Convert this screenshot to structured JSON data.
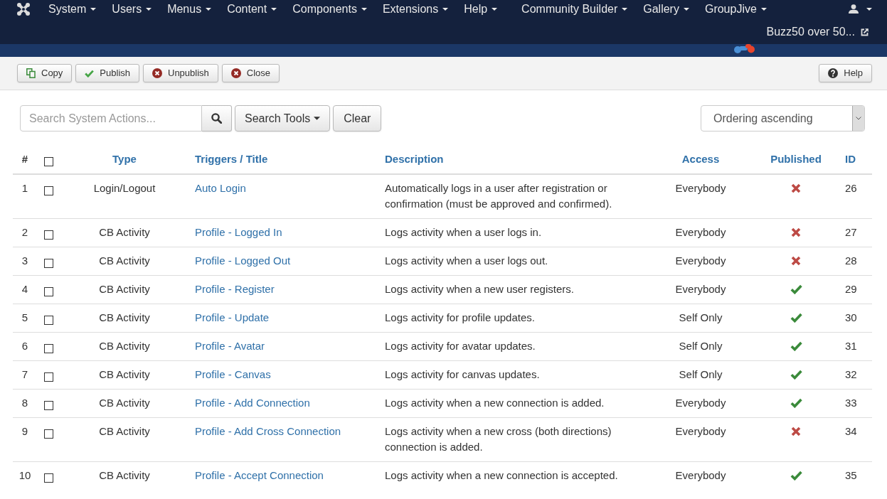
{
  "navbar": {
    "menus": [
      {
        "label": "System"
      },
      {
        "label": "Users"
      },
      {
        "label": "Menus"
      },
      {
        "label": "Content"
      },
      {
        "label": "Components"
      },
      {
        "label": "Extensions"
      },
      {
        "label": "Help"
      }
    ],
    "extension_menus": [
      {
        "label": "Community Builder"
      },
      {
        "label": "Gallery"
      },
      {
        "label": "GroupJive"
      }
    ],
    "site_link": {
      "label": "Buzz50 over 50..."
    }
  },
  "toolbar": {
    "buttons": [
      {
        "kind": "copy",
        "label": "Copy"
      },
      {
        "kind": "publish",
        "label": "Publish"
      },
      {
        "kind": "unpublish",
        "label": "Unpublish"
      },
      {
        "kind": "close",
        "label": "Close"
      }
    ],
    "help_button": {
      "label": "Help"
    }
  },
  "filters": {
    "search": {
      "placeholder": "Search System Actions..."
    },
    "search_tools": {
      "label": "Search Tools"
    },
    "clear": {
      "label": "Clear"
    },
    "ordering": {
      "value": "Ordering ascending"
    }
  },
  "table": {
    "columns": [
      {
        "kind": "plain",
        "label": "#"
      },
      {
        "kind": "checkbox",
        "checked": false
      },
      {
        "kind": "sortable",
        "label": "Type"
      },
      {
        "kind": "sortable",
        "label": "Triggers / Title"
      },
      {
        "kind": "sortable",
        "label": "Description"
      },
      {
        "kind": "sortable",
        "label": "Access"
      },
      {
        "kind": "sortable",
        "label": "Published"
      },
      {
        "kind": "sortable",
        "label": "ID"
      }
    ],
    "rows": [
      {
        "number": "1",
        "checked": false,
        "type": "Login/Logout",
        "title": "Auto Login",
        "description": "Automatically logs in a user after registration or confirmation (must be approved and confirmed).",
        "access": "Everybody",
        "published": false,
        "id": "26"
      },
      {
        "number": "2",
        "checked": false,
        "type": "CB Activity",
        "title": "Profile - Logged In",
        "description": "Logs activity when a user logs in.",
        "access": "Everybody",
        "published": false,
        "id": "27"
      },
      {
        "number": "3",
        "checked": false,
        "type": "CB Activity",
        "title": "Profile - Logged Out",
        "description": "Logs activity when a user logs out.",
        "access": "Everybody",
        "published": false,
        "id": "28"
      },
      {
        "number": "4",
        "checked": false,
        "type": "CB Activity",
        "title": "Profile - Register",
        "description": "Logs activity when a new user registers.",
        "access": "Everybody",
        "published": true,
        "id": "29"
      },
      {
        "number": "5",
        "checked": false,
        "type": "CB Activity",
        "title": "Profile - Update",
        "description": "Logs activity for profile updates.",
        "access": "Self Only",
        "published": true,
        "id": "30"
      },
      {
        "number": "6",
        "checked": false,
        "type": "CB Activity",
        "title": "Profile - Avatar",
        "description": "Logs activity for avatar updates.",
        "access": "Self Only",
        "published": true,
        "id": "31"
      },
      {
        "number": "7",
        "checked": false,
        "type": "CB Activity",
        "title": "Profile - Canvas",
        "description": "Logs activity for canvas updates.",
        "access": "Self Only",
        "published": true,
        "id": "32"
      },
      {
        "number": "8",
        "checked": false,
        "type": "CB Activity",
        "title": "Profile - Add Connection",
        "description": "Logs activity when a new connection is added.",
        "access": "Everybody",
        "published": true,
        "id": "33"
      },
      {
        "number": "9",
        "checked": false,
        "type": "CB Activity",
        "title": "Profile - Add Cross Connection",
        "description": "Logs activity when a new cross (both directions) connection is added.",
        "access": "Everybody",
        "published": false,
        "id": "34"
      },
      {
        "number": "10",
        "checked": false,
        "type": "CB Activity",
        "title": "Profile - Accept Connection",
        "description": "Logs activity when a new connection is accepted.",
        "access": "Everybody",
        "published": true,
        "id": "35"
      }
    ]
  }
}
